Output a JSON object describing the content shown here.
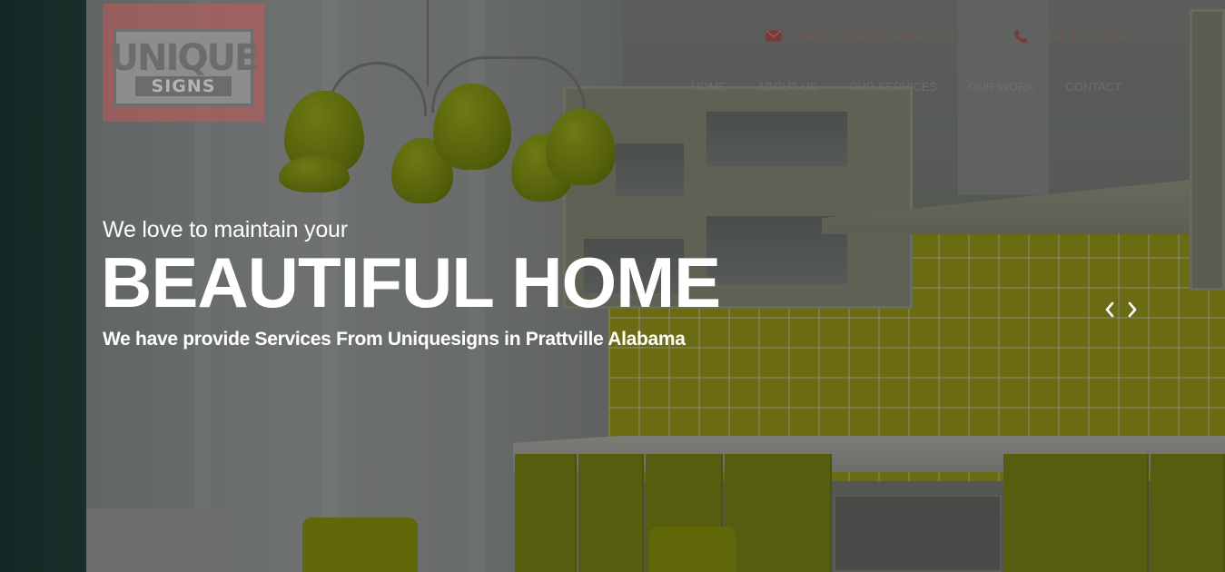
{
  "header": {
    "logo": {
      "line1": "UNIQUE",
      "line2": "SIGNS"
    },
    "contact": {
      "email": "uniquesignz@hotmail.com",
      "email_icon": "envelope-icon",
      "phone": "334-322-3584",
      "phone_icon": "phone-icon"
    },
    "nav": {
      "items": [
        {
          "label": "HOME"
        },
        {
          "label": "ABOUT US"
        },
        {
          "label": "OUR SERVICES"
        },
        {
          "label": "OUR WORK"
        },
        {
          "label": "CONTACT"
        }
      ]
    }
  },
  "hero": {
    "pre_title": "We love to maintain your",
    "title": "BEAUTIFUL HOME",
    "subtitle": "We have provide Services From Uniquesigns in Prattville Alabama"
  },
  "slider": {
    "prev_icon": "chevron-left-icon",
    "next_icon": "chevron-right-icon"
  },
  "colors": {
    "contact_text": "#6e5a58",
    "nav_text": "#6c6e6a",
    "hero_text": "#ffffff",
    "logo_bg": "#c45a5a"
  }
}
